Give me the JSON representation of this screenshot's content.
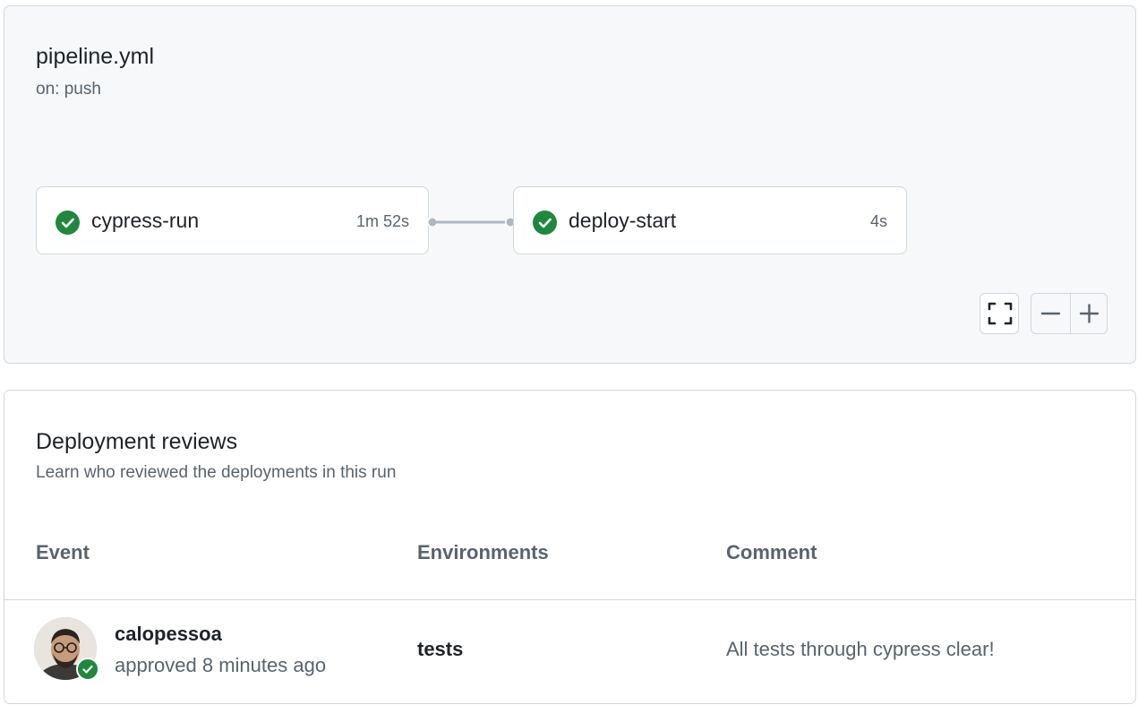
{
  "workflow": {
    "title": "pipeline.yml",
    "trigger": "on: push",
    "jobs": [
      {
        "name": "cypress-run",
        "duration": "1m 52s",
        "status": "success"
      },
      {
        "name": "deploy-start",
        "duration": "4s",
        "status": "success"
      }
    ],
    "controls": {
      "fullscreen_icon": "fullscreen-icon",
      "zoom_out_icon": "minus-icon",
      "zoom_in_icon": "plus-icon"
    }
  },
  "reviews": {
    "title": "Deployment reviews",
    "subtitle": "Learn who reviewed the deployments in this run",
    "columns": {
      "event": "Event",
      "environments": "Environments",
      "comment": "Comment"
    },
    "rows": [
      {
        "user": "calopessoa",
        "status": "approved 8 minutes ago",
        "environment": "tests",
        "comment": "All tests through cypress clear!"
      }
    ]
  },
  "colors": {
    "success": "#1f883d",
    "muted_text": "#59636e",
    "border": "#d0d7de",
    "panel_bg": "#f6f8fa"
  }
}
